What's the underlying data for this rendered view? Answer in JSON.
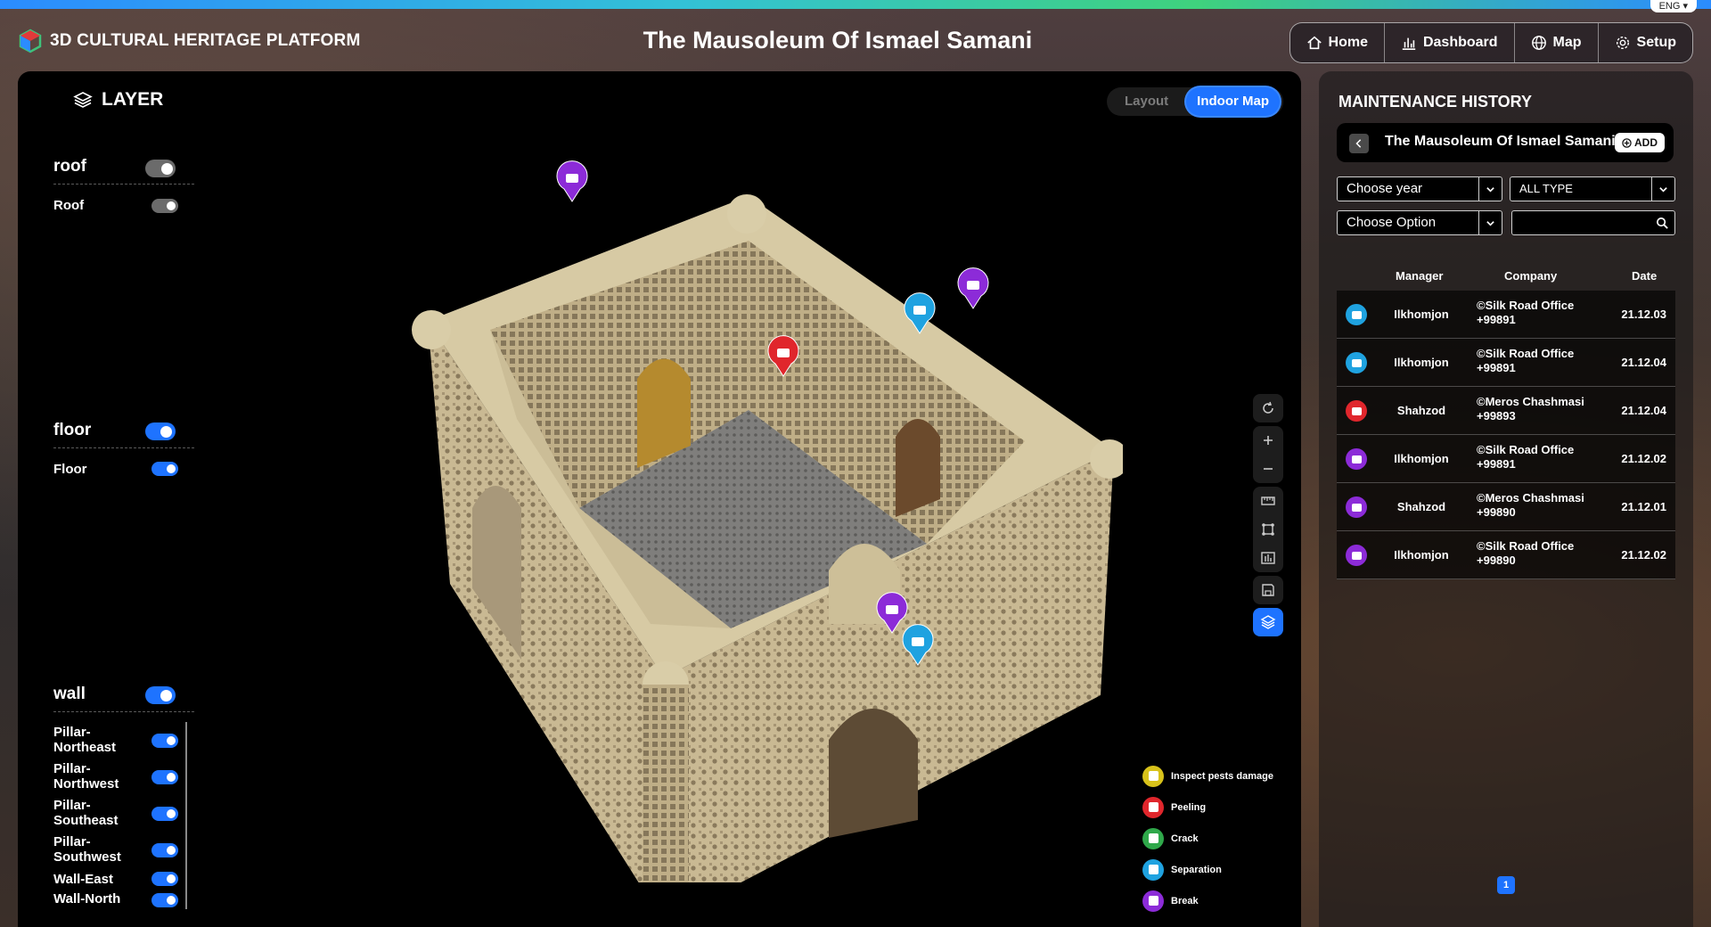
{
  "lang": "ENG",
  "brand": "3D CULTURAL HERITAGE PLATFORM",
  "title": "The Mausoleum Of Ismael Samani",
  "nav": [
    {
      "label": "Home",
      "icon": "home-icon"
    },
    {
      "label": "Dashboard",
      "icon": "chart-icon"
    },
    {
      "label": "Map",
      "icon": "globe-icon"
    },
    {
      "label": "Setup",
      "icon": "gear-icon"
    }
  ],
  "layer": {
    "title": "LAYER",
    "groups": [
      {
        "name": "roof",
        "on": false,
        "items": [
          {
            "label": "Roof",
            "on": false
          }
        ]
      },
      {
        "name": "floor",
        "on": true,
        "items": [
          {
            "label": "Floor",
            "on": true
          }
        ]
      },
      {
        "name": "wall",
        "on": true,
        "items": [
          {
            "label": "Pillar-\nNortheast",
            "on": true
          },
          {
            "label": "Pillar-\nNorthwest",
            "on": true
          },
          {
            "label": "Pillar-\nSoutheast",
            "on": true
          },
          {
            "label": "Pillar-\nSouthwest",
            "on": true
          },
          {
            "label": "Wall-East",
            "on": true
          },
          {
            "label": "Wall-North",
            "on": true
          }
        ]
      }
    ]
  },
  "view_toggle": {
    "options": [
      "Layout",
      "Indoor Map"
    ],
    "selected": "Indoor Map"
  },
  "legend": [
    {
      "label": "Inspect pests damage",
      "color": "#d8c21a"
    },
    {
      "label": "Peeling",
      "color": "#e0262c"
    },
    {
      "label": "Crack",
      "color": "#2fa84a"
    },
    {
      "label": "Separation",
      "color": "#1fa2e0"
    },
    {
      "label": "Break",
      "color": "#8c2bd8"
    }
  ],
  "maintenance": {
    "title": "MAINTENANCE HISTORY",
    "site": "The Mausoleum Of Ismael Samani",
    "add_label": "ADD",
    "year_select": "Choose year",
    "type_select": "ALL TYPE",
    "option_select": "Choose Option",
    "search_value": "",
    "columns": [
      "Manager",
      "Company",
      "Date"
    ],
    "rows": [
      {
        "type": "Separation",
        "color": "#1fa2e0",
        "manager": "Ilkhomjon",
        "company": "©Silk Road Office",
        "phone": "+99891",
        "date": "21.12.03"
      },
      {
        "type": "Separation",
        "color": "#1fa2e0",
        "manager": "Ilkhomjon",
        "company": "©Silk Road Office",
        "phone": "+99891",
        "date": "21.12.04"
      },
      {
        "type": "Peeling",
        "color": "#e0262c",
        "manager": "Shahzod",
        "company": "©Meros Chashmasi",
        "phone": "+99893",
        "date": "21.12.04"
      },
      {
        "type": "Break",
        "color": "#8c2bd8",
        "manager": "Ilkhomjon",
        "company": "©Silk Road Office",
        "phone": "+99891",
        "date": "21.12.02"
      },
      {
        "type": "Break",
        "color": "#8c2bd8",
        "manager": "Shahzod",
        "company": "©Meros Chashmasi",
        "phone": "+99890",
        "date": "21.12.01"
      },
      {
        "type": "Break",
        "color": "#8c2bd8",
        "manager": "Ilkhomjon",
        "company": "©Silk Road Office",
        "phone": "+99890",
        "date": "21.12.02"
      }
    ],
    "page": "1"
  },
  "markers": [
    {
      "type": "Break",
      "color": "#8c2bd8"
    },
    {
      "type": "Break",
      "color": "#8c2bd8"
    },
    {
      "type": "Separation",
      "color": "#1fa2e0"
    },
    {
      "type": "Peeling",
      "color": "#e0262c"
    },
    {
      "type": "Break",
      "color": "#8c2bd8"
    },
    {
      "type": "Separation",
      "color": "#1fa2e0"
    }
  ]
}
